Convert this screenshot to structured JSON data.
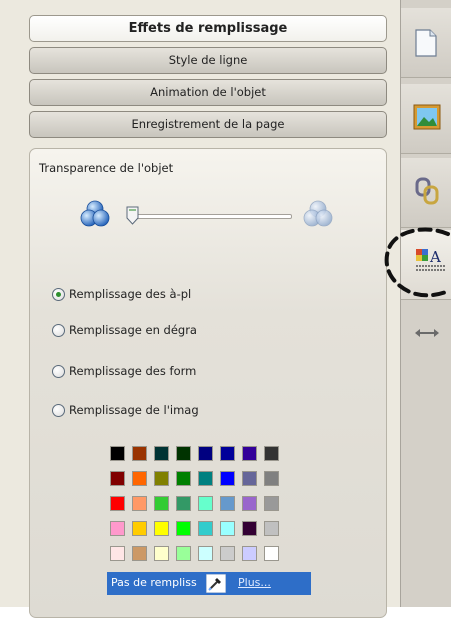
{
  "accordion": {
    "fill_effects": "Effets de remplissage",
    "line_style": "Style de ligne",
    "object_animation": "Animation de l'objet",
    "page_saving": "Enregistrement de la page"
  },
  "transparency": {
    "label": "Transparence de l'objet",
    "level": 0.0
  },
  "fill_options": {
    "selected_index": 0,
    "items": [
      "Remplissage des à-pl",
      "Remplissage en dégra",
      "Remplissage des form",
      "Remplissage de l'imag"
    ]
  },
  "palette": {
    "rows": [
      [
        "#000000",
        "#993300",
        "#003333",
        "#003300",
        "#000080",
        "#000099",
        "#330099",
        "#333333"
      ],
      [
        "#800000",
        "#ff6600",
        "#808000",
        "#008000",
        "#008080",
        "#0000ff",
        "#666699",
        "#808080"
      ],
      [
        "#ff0000",
        "#ff9966",
        "#33cc33",
        "#339966",
        "#66ffcc",
        "#6699cc",
        "#9966cc",
        "#999999"
      ],
      [
        "#ff99cc",
        "#ffcc00",
        "#ffff00",
        "#00ff00",
        "#33cccc",
        "#99ffff",
        "#330033",
        "#c0c0c0"
      ],
      [
        "#ffe6e6",
        "#cc9966",
        "#ffffcc",
        "#99ff99",
        "#ccffff",
        "#cccccc",
        "#ccccff",
        "#ffffff"
      ]
    ]
  },
  "bottom_bar": {
    "no_fill": "Pas de rempliss",
    "more": "Plus..."
  },
  "icons": {
    "rail": [
      "page-icon",
      "picture-icon",
      "chain-link-icon",
      "text-format-icon",
      "resize-arrows-icon"
    ]
  }
}
